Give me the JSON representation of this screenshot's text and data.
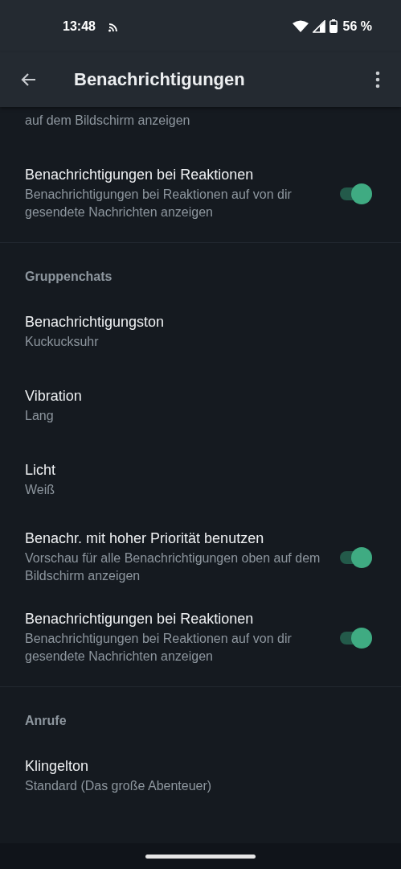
{
  "status_bar": {
    "time": "13:48",
    "battery": "56 %"
  },
  "app_bar": {
    "title": "Benachrichtigungen"
  },
  "sections": [
    {
      "items": [
        {
          "kind": "fragment",
          "subtitle": "auf dem Bildschirm anzeigen"
        },
        {
          "kind": "toggle",
          "title": "Benachrichtigungen bei Reaktionen",
          "subtitle": "Benachrichtigungen bei Reaktionen auf von dir gesendete Nachrichten anzeigen",
          "on": true
        }
      ]
    },
    {
      "header": "Gruppenchats",
      "items": [
        {
          "kind": "value",
          "title": "Benachrichtigungston",
          "subtitle": "Kuckucksuhr"
        },
        {
          "kind": "value",
          "title": "Vibration",
          "subtitle": "Lang"
        },
        {
          "kind": "value",
          "title": "Licht",
          "subtitle": "Weiß"
        },
        {
          "kind": "toggle",
          "title": "Benachr. mit hoher Priorität benutzen",
          "subtitle": "Vorschau für alle Benachrichtigungen oben auf dem Bildschirm anzeigen",
          "on": true
        },
        {
          "kind": "toggle",
          "title": "Benachrichtigungen bei Reaktionen",
          "subtitle": "Benachrichtigungen bei Reaktionen auf von dir gesendete Nachrichten anzeigen",
          "on": true
        }
      ]
    },
    {
      "header": "Anrufe",
      "items": [
        {
          "kind": "value",
          "title": "Klingelton",
          "subtitle": "Standard (Das große Abenteuer)"
        }
      ]
    }
  ]
}
